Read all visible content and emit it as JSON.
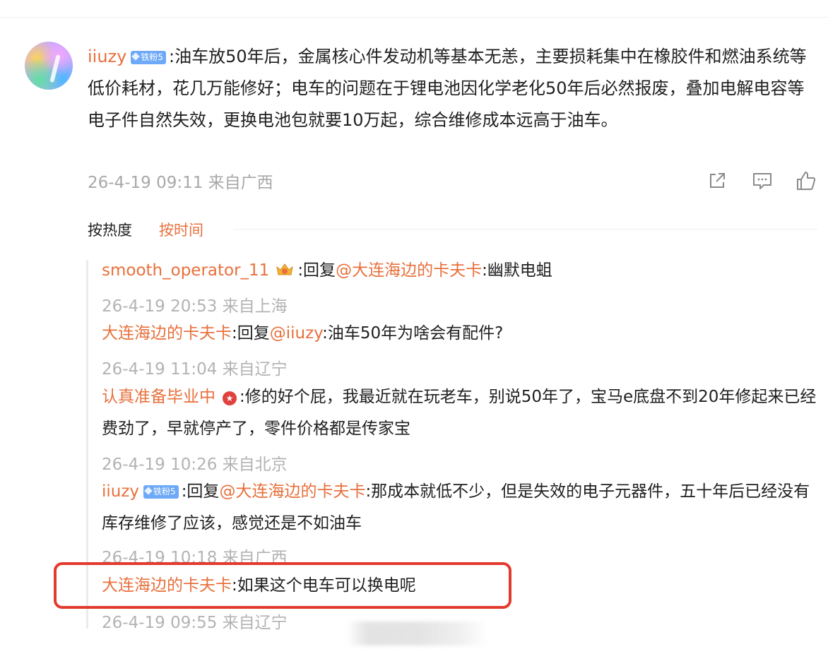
{
  "post": {
    "username": "iiuzy",
    "badge": "铁粉5",
    "text": ":油车放50年后，金属核心件发动机等基本无恙，主要损耗集中在橡胶件和燃油系统等低价耗材，花几万能修好；电车的问题在于锂电池因化学老化50年后必然报废，叠加电解电容等电子件自然失效，更换电池包就要10万起，综合维修成本远高于油车。",
    "meta": "26-4-19 09:11 来自广西",
    "actions": [
      {
        "icon": "share-icon"
      },
      {
        "icon": "comment-icon"
      },
      {
        "icon": "like-icon"
      }
    ]
  },
  "sort": {
    "hot": "按热度",
    "time": "按时间"
  },
  "replies": [
    {
      "user": "smooth_operator_11",
      "badge_icon": "crown-icon",
      "prefix": ":回复",
      "mention": "@大连海边的卡夫卡",
      "text": ":幽默电蛆",
      "meta": "26-4-19 20:53 来自上海"
    },
    {
      "user": "大连海边的卡夫卡",
      "prefix": ":回复",
      "mention": "@iiuzy",
      "text": ":油车50年为啥会有配件?",
      "meta": "26-4-19 11:04 来自辽宁"
    },
    {
      "user": "认真准备毕业中",
      "badge_icon": "red-star-badge-icon",
      "text": ":修的好个屁，我最近就在玩老车，别说50年了，宝马e底盘不到20年修起来已经费劲了，早就停产了，零件价格都是传家宝",
      "meta": "26-4-19 10:26 来自北京"
    },
    {
      "user": "iiuzy",
      "badge": "铁粉5",
      "prefix": ":回复",
      "mention": "@大连海边的卡夫卡",
      "text": ":那成本就低不少，但是失效的电子元器件，五十年后已经没有库存维修了应该，感觉还是不如油车",
      "meta": "26-4-19 10:18 来自广西"
    },
    {
      "user": "大连海边的卡夫卡",
      "text": ":如果这个电车可以换电呢",
      "meta": "26-4-19 09:55 来自辽宁"
    }
  ],
  "colors": {
    "accent": "#e8703c",
    "meta": "#a8a8a8",
    "highlight": "#e23b2e",
    "badge": "#6ea9f7"
  }
}
